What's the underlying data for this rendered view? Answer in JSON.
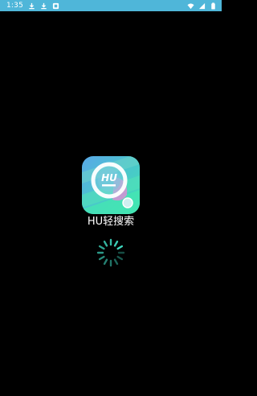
{
  "status_bar": {
    "time": "1:35",
    "left_icons": [
      "download-icon",
      "download-icon",
      "notification-app-icon"
    ],
    "right_icons": [
      "wifi-icon",
      "cell-signal-icon",
      "battery-icon"
    ],
    "background": "#4fb6d9"
  },
  "splash": {
    "app_name": "HU轻搜索",
    "icon_text": "HU",
    "icon_colors": {
      "teal": "#3fd9b8",
      "blue": "#4d9ce6",
      "pink": "#d98fd6",
      "ring": "#ffffff"
    },
    "spinner_color": "#3fd9c0",
    "background": "#000000"
  }
}
